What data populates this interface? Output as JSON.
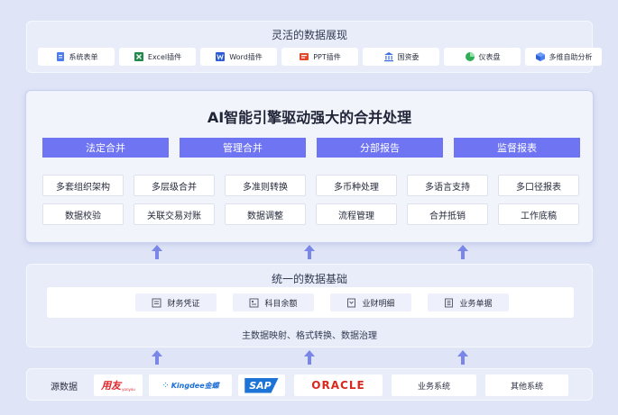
{
  "display": {
    "title": "灵活的数据展现",
    "tools": [
      {
        "label": "系统表单",
        "icon": "form-icon"
      },
      {
        "label": "Excel插件",
        "icon": "excel-icon"
      },
      {
        "label": "Word插件",
        "icon": "word-icon"
      },
      {
        "label": "PPT插件",
        "icon": "ppt-icon"
      },
      {
        "label": "国资委",
        "icon": "government-building-icon"
      },
      {
        "label": "仪表盘",
        "icon": "pie-chart-icon"
      },
      {
        "label": "多维自助分析",
        "icon": "cube-icon"
      }
    ]
  },
  "engine": {
    "title": "AI智能引擎驱动强大的合并处理",
    "categories": [
      "法定合并",
      "管理合并",
      "分部报告",
      "监督报表"
    ],
    "features": [
      "多套组织架构",
      "多层级合并",
      "多准则转换",
      "多币种处理",
      "多语言支持",
      "多口径报表",
      "数据校验",
      "关联交易对账",
      "数据调整",
      "流程管理",
      "合并抵销",
      "工作底稿"
    ]
  },
  "foundation": {
    "title": "统一的数据基础",
    "items": [
      {
        "label": "财务凭证",
        "icon": "voucher-icon"
      },
      {
        "label": "科目余额",
        "icon": "balance-icon"
      },
      {
        "label": "业财明细",
        "icon": "detail-icon"
      },
      {
        "label": "业务单据",
        "icon": "document-icon"
      }
    ],
    "footer": "主数据映射、格式转换、数据治理"
  },
  "sources": {
    "label": "源数据",
    "logos": [
      {
        "text": "用友",
        "sub": "yonyou"
      },
      {
        "text": "Kingdee金蝶"
      },
      {
        "text": "SAP"
      },
      {
        "text": "ORACLE"
      }
    ],
    "systems": [
      "业务系统",
      "其他系统"
    ]
  },
  "colors": {
    "accent": "#6f74f2",
    "arrow": "#7a86e8",
    "background": "#dfe5f7"
  }
}
